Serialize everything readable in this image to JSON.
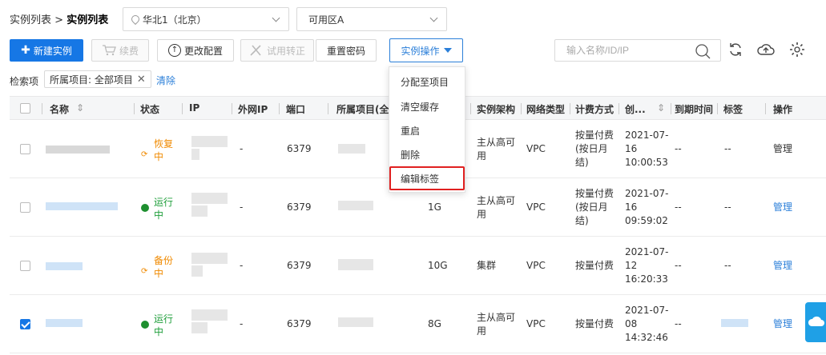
{
  "breadcrumb": {
    "parent": "实例列表",
    "separator": " > ",
    "current": "实例列表"
  },
  "region_select": {
    "value": "华北1（北京）"
  },
  "zone_select": {
    "value": "可用区A"
  },
  "toolbar": {
    "create": "新建实例",
    "renew": "续费",
    "change_config": "更改配置",
    "trial_convert": "试用转正",
    "reset_password": "重置密码",
    "instance_ops": "实例操作"
  },
  "search": {
    "placeholder": "输入名称/ID/IP"
  },
  "filter": {
    "label": "检索项",
    "tag": "所属项目: 全部项目",
    "clear": "清除"
  },
  "columns": {
    "name": "名称",
    "status": "状态",
    "ip": "IP",
    "public_ip": "外网IP",
    "port": "端口",
    "project": "所属项目(全...",
    "arch": "实例架构",
    "network": "网络类型",
    "billing": "计费方式",
    "created": "创...",
    "expire": "到期时间",
    "tags": "标签",
    "ops": "操作"
  },
  "dropdown": [
    "分配至项目",
    "清空缓存",
    "重启",
    "删除",
    "编辑标签"
  ],
  "rows": [
    {
      "status": "恢复中",
      "status_color": "#f08a00",
      "public_ip": "-",
      "port": "6379",
      "memory": "",
      "arch": "主从高可用",
      "network": "VPC",
      "billing": "按量付费(按日月结)",
      "created": "2021-07-16 10:00:53",
      "expire": "--",
      "tags": "--",
      "op": "管理",
      "checked": false
    },
    {
      "status": "运行中",
      "status_color": "#1e9e3a",
      "public_ip": "-",
      "port": "6379",
      "memory": "1G",
      "arch": "主从高可用",
      "network": "VPC",
      "billing": "按量付费(按日月结)",
      "created": "2021-07-16 09:59:02",
      "expire": "--",
      "tags": "--",
      "op": "管理",
      "checked": false
    },
    {
      "status": "备份中",
      "status_color": "#f08a00",
      "public_ip": "-",
      "port": "6379",
      "memory": "10G",
      "arch": "集群",
      "network": "VPC",
      "billing": "按量付费",
      "created": "2021-07-12 16:20:33",
      "expire": "--",
      "tags": "--",
      "op": "管理",
      "checked": false
    },
    {
      "status": "运行中",
      "status_color": "#1e9e3a",
      "public_ip": "-",
      "port": "6379",
      "memory": "8G",
      "arch": "主从高可用",
      "network": "VPC",
      "billing": "按量付费",
      "created": "2021-07-08 14:32:46",
      "expire": "--",
      "tags": "",
      "op": "管理",
      "checked": true
    }
  ]
}
